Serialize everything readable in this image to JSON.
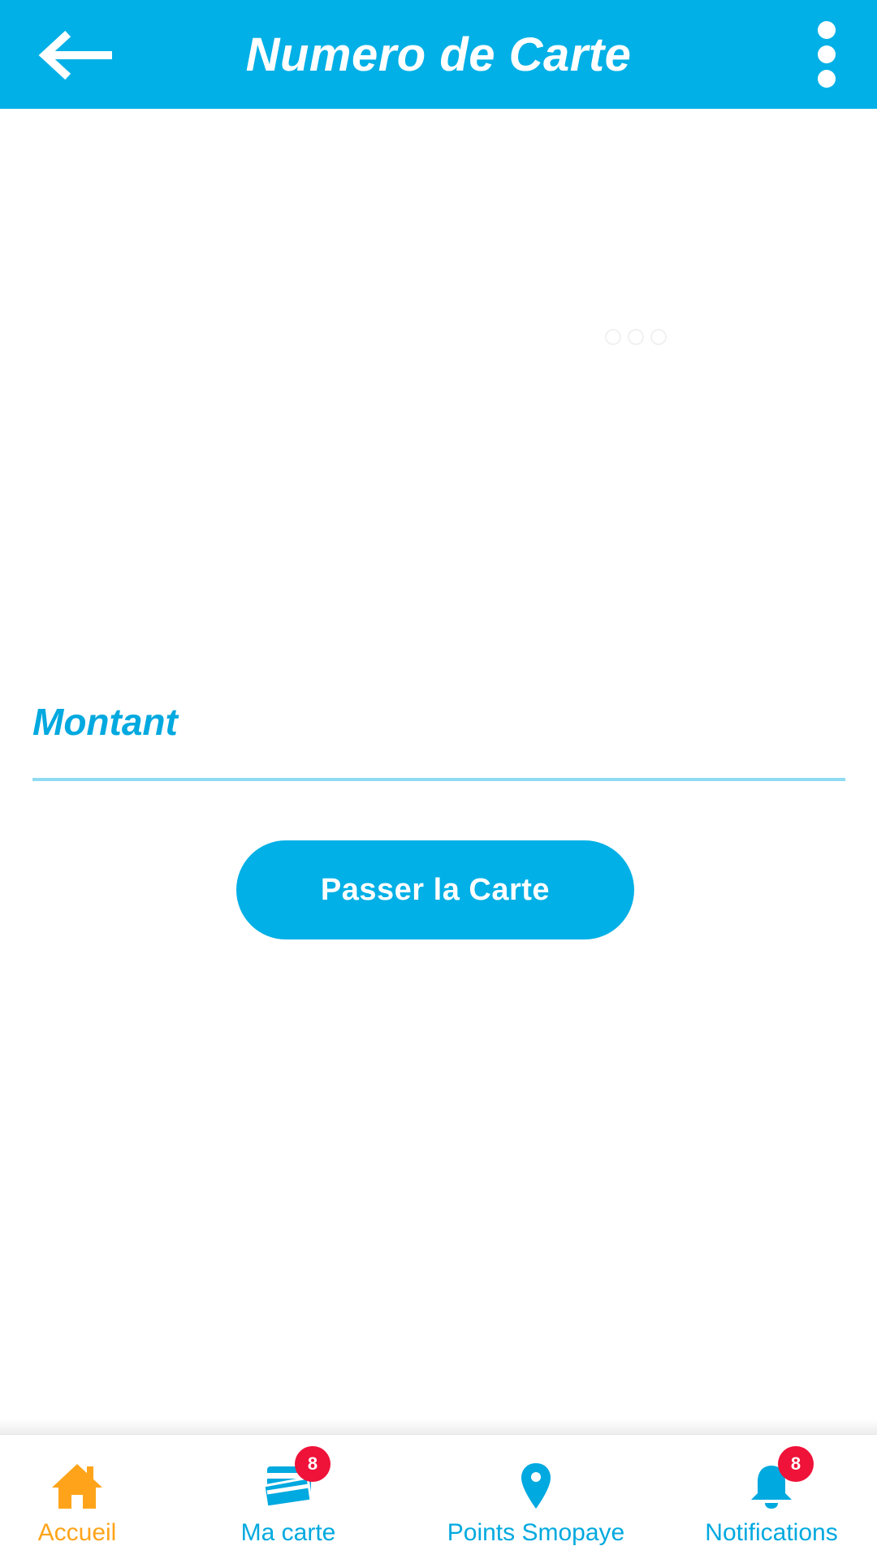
{
  "header": {
    "title": "Numero de Carte"
  },
  "amount": {
    "label": "Montant",
    "value": ""
  },
  "actions": {
    "pass_card_label": "Passer la Carte"
  },
  "bottom_nav": {
    "items": [
      {
        "label": "Accueil",
        "icon": "home-icon",
        "active": true
      },
      {
        "label": "Ma carte",
        "icon": "card-icon",
        "badge": "8"
      },
      {
        "label": "Points Smopaye",
        "icon": "location-pin-icon"
      },
      {
        "label": "Notifications",
        "icon": "bell-icon",
        "badge": "8"
      }
    ]
  },
  "colors": {
    "primary": "#00b0e6",
    "accent": "#ffa41a",
    "badge": "#ef1239"
  }
}
